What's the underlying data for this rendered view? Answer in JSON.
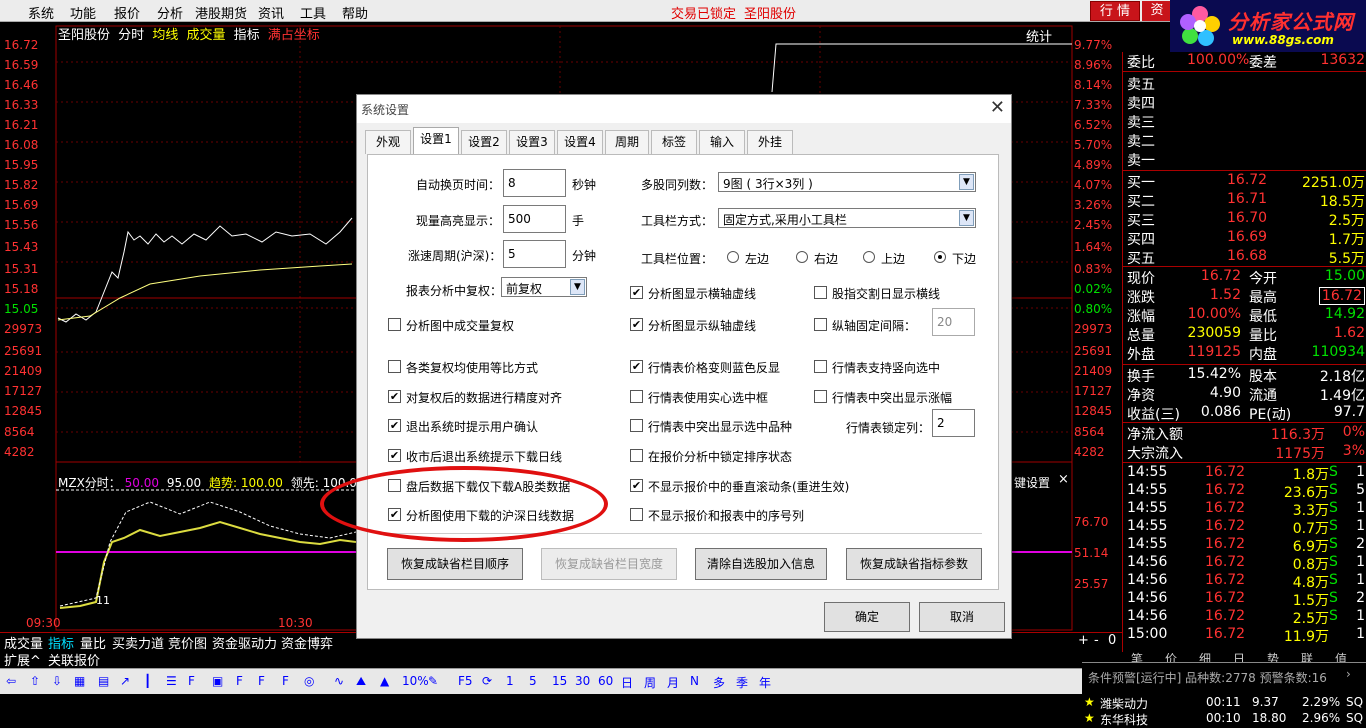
{
  "menu": {
    "items": [
      "系统",
      "功能",
      "报价",
      "分析",
      "港股期货",
      "资讯",
      "工具",
      "帮助"
    ],
    "status_locked": "交易已锁定",
    "status_stock": "圣阳股份",
    "btn_quote": "行 情",
    "btn_trade": "资"
  },
  "logo": {
    "title": "分析家公式网",
    "url": "www.88gs.com"
  },
  "chart": {
    "header": {
      "name": "圣阳股份",
      "tab1": "分时",
      "tab2": "均线",
      "tab3": "成交量",
      "tab4": "指标",
      "tab5": "满占坐标"
    },
    "stats_label": "统计",
    "left_axis": [
      "16.72",
      "16.59",
      "16.46",
      "16.33",
      "16.21",
      "16.08",
      "15.95",
      "15.82",
      "15.69",
      "15.56",
      "15.43",
      "15.31",
      "15.18",
      "15.05",
      "29973",
      "25691",
      "21409",
      "17127",
      "12845",
      "8564",
      "4282"
    ],
    "right_axis": [
      "9.77%",
      "8.96%",
      "8.14%",
      "7.33%",
      "6.52%",
      "5.70%",
      "4.89%",
      "4.07%",
      "3.26%",
      "2.45%",
      "1.64%",
      "0.83%",
      "0.02%",
      "0.80%",
      "29973",
      "25691",
      "21409",
      "17127",
      "12845",
      "8564",
      "4282"
    ],
    "indicator_label": "MZX分时：",
    "indicator_vals": {
      "a": "50.00",
      "b": "95.00",
      "c_lbl": "趋势:",
      "c": "100.00",
      "d_lbl": "领先:",
      "d": "100.00",
      "e": "底部"
    },
    "indicator_axis": [
      "76.70",
      "51.14",
      "25.57"
    ],
    "key_settings": "键设置",
    "time_labels": [
      "09:30",
      "10:30"
    ],
    "mark": "11"
  },
  "quote": {
    "wei_bi_lbl": "委比",
    "wei_bi": "100.00%",
    "wei_cha_lbl": "委差",
    "wei_cha": "13632",
    "sells": [
      "卖五",
      "卖四",
      "卖三",
      "卖二",
      "卖一"
    ],
    "buys": [
      {
        "lbl": "买一",
        "price": "16.72",
        "vol": "2251.0万"
      },
      {
        "lbl": "买二",
        "price": "16.71",
        "vol": "18.5万"
      },
      {
        "lbl": "买三",
        "price": "16.70",
        "vol": "2.5万"
      },
      {
        "lbl": "买四",
        "price": "16.69",
        "vol": "1.7万"
      },
      {
        "lbl": "买五",
        "price": "16.68",
        "vol": "5.5万"
      }
    ],
    "stats": [
      {
        "l1": "现价",
        "v1": "16.72",
        "l2": "今开",
        "v2": "15.00"
      },
      {
        "l1": "涨跌",
        "v1": "1.52",
        "l2": "最高",
        "v2": "16.72"
      },
      {
        "l1": "涨幅",
        "v1": "10.00%",
        "l2": "最低",
        "v2": "14.92"
      },
      {
        "l1": "总量",
        "v1": "230059",
        "l2": "量比",
        "v2": "1.62"
      },
      {
        "l1": "外盘",
        "v1": "119125",
        "l2": "内盘",
        "v2": "110934"
      }
    ],
    "stats2": [
      {
        "l1": "换手",
        "v1": "15.42%",
        "l2": "股本",
        "v2": "2.18亿"
      },
      {
        "l1": "净资",
        "v1": "4.90",
        "l2": "流通",
        "v2": "1.49亿"
      },
      {
        "l1": "收益(三)",
        "v1": "0.086",
        "l2": "PE(动)",
        "v2": "97.7"
      }
    ],
    "flow": [
      {
        "lbl": "净流入额",
        "v": "116.3万",
        "p": "0%"
      },
      {
        "lbl": "大宗流入",
        "v": "1175万",
        "p": "3%"
      }
    ],
    "ticks": [
      {
        "t": "14:55",
        "p": "16.72",
        "v": "1.8万",
        "s": "S",
        "n": "1"
      },
      {
        "t": "14:55",
        "p": "16.72",
        "v": "23.6万",
        "s": "S",
        "n": "5"
      },
      {
        "t": "14:55",
        "p": "16.72",
        "v": "3.3万",
        "s": "S",
        "n": "1"
      },
      {
        "t": "14:55",
        "p": "16.72",
        "v": "0.7万",
        "s": "S",
        "n": "1"
      },
      {
        "t": "14:55",
        "p": "16.72",
        "v": "6.9万",
        "s": "S",
        "n": "2"
      },
      {
        "t": "14:56",
        "p": "16.72",
        "v": "0.8万",
        "s": "S",
        "n": "1"
      },
      {
        "t": "14:56",
        "p": "16.72",
        "v": "4.8万",
        "s": "S",
        "n": "1"
      },
      {
        "t": "14:56",
        "p": "16.72",
        "v": "1.5万",
        "s": "S",
        "n": "2"
      },
      {
        "t": "14:56",
        "p": "16.72",
        "v": "2.5万",
        "s": "S",
        "n": "1"
      },
      {
        "t": "15:00",
        "p": "16.72",
        "v": "11.9万",
        "s": "",
        "n": "1"
      }
    ],
    "bottom_tabs": [
      "笔",
      "价",
      "细",
      "日",
      "势",
      "联",
      "值"
    ]
  },
  "bottom_tabs": [
    "成交量",
    "指标",
    "量比",
    "买卖力道",
    "竞价图",
    "资金驱动力",
    "资金博弈"
  ],
  "bottom_tabs2": [
    "扩展^",
    "关联报价"
  ],
  "toolbar": {
    "periods": [
      "1",
      "5",
      "15",
      "30",
      "60",
      "日",
      "周",
      "月",
      "N",
      "多",
      "季",
      "年"
    ],
    "pct": "10%"
  },
  "notif": {
    "header": "条件预警[运行中] 品种数:2778 预警条数:16",
    "rows": [
      {
        "name": "潍柴动力",
        "time": "00:11",
        "p": "9.37",
        "c": "2.29%",
        "x": "SQ"
      },
      {
        "name": "东华科技",
        "time": "00:10",
        "p": "18.80",
        "c": "2.96%",
        "x": "SQ"
      }
    ]
  },
  "dialog": {
    "title": "系统设置",
    "tabs": [
      "外观",
      "设置1",
      "设置2",
      "设置3",
      "设置4",
      "周期",
      "标签",
      "输入",
      "外挂"
    ],
    "active_tab": "设置1",
    "auto_page_lbl": "自动换页时间：",
    "auto_page_val": "8",
    "auto_page_unit": "秒钟",
    "vol_hl_lbl": "现量高亮显示：",
    "vol_hl_val": "500",
    "vol_hl_unit": "手",
    "speed_lbl": "涨速周期(沪深)：",
    "speed_val": "5",
    "speed_unit": "分钟",
    "adj_lbl": "报表分析中复权：",
    "adj_val": "前复权",
    "multi_lbl": "多股同列数：",
    "multi_val": "9图 ( 3行×3列 )",
    "toolbar_mode_lbl": "工具栏方式：",
    "toolbar_mode_val": "固定方式,采用小工具栏",
    "toolbar_pos_lbl": "工具栏位置：",
    "radios": [
      "左边",
      "右边",
      "上边",
      "下边"
    ],
    "checks": [
      {
        "label": "分析图显示横轴虚线",
        "checked": true
      },
      {
        "label": "股指交割日显示横线",
        "checked": false
      },
      {
        "label": "分析图中成交量复权",
        "checked": false
      },
      {
        "label": "分析图显示纵轴虚线",
        "checked": true
      },
      {
        "label": "纵轴固定间隔：",
        "checked": false
      },
      {
        "label": "各类复权均使用等比方式",
        "checked": false
      },
      {
        "label": "行情表价格变则蓝色反显",
        "checked": true
      },
      {
        "label": "行情表支持竖向选中",
        "checked": false
      },
      {
        "label": "对复权后的数据进行精度对齐",
        "checked": true
      },
      {
        "label": "行情表使用实心选中框",
        "checked": false
      },
      {
        "label": "行情表中突出显示涨幅",
        "checked": false
      },
      {
        "label": "退出系统时提示用户确认",
        "checked": true
      },
      {
        "label": "行情表中突出显示选中品种",
        "checked": false
      },
      {
        "label": "收市后退出系统提示下载日线",
        "checked": true
      },
      {
        "label": "在报价分析中锁定排序状态",
        "checked": false
      },
      {
        "label": "盘后数据下载仅下载A股类数据",
        "checked": false
      },
      {
        "label": "不显示报价中的垂直滚动条(重进生效)",
        "checked": true
      },
      {
        "label": "分析图使用下载的沪深日线数据",
        "checked": true
      },
      {
        "label": "不显示报价和报表中的序号列",
        "checked": false
      }
    ],
    "axis_interval_val": "20",
    "lock_col_lbl": "行情表锁定列：",
    "lock_col_val": "2",
    "buttons": [
      "恢复成缺省栏目顺序",
      "恢复成缺省栏目宽度",
      "清除自选股加入信息",
      "恢复成缺省指标参数"
    ],
    "ok": "确定",
    "cancel": "取消"
  }
}
